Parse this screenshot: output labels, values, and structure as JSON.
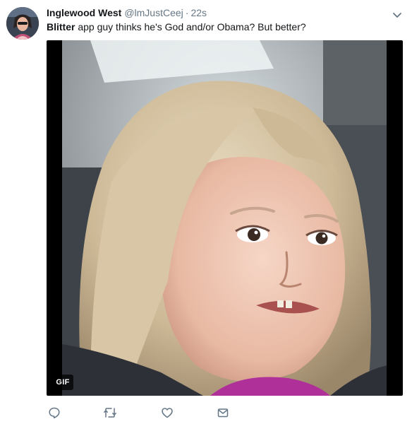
{
  "tweet": {
    "display_name": "Inglewood West",
    "handle": "@lmJustCeej",
    "separator": "·",
    "time": "22s",
    "text_bold": "Blitter",
    "text_rest": " app guy thinks he's God and/or Obama? But better?"
  },
  "media": {
    "badge": "GIF"
  },
  "icons": {
    "more": "chevron-down-icon",
    "reply": "reply-icon",
    "retweet": "retweet-icon",
    "like": "heart-icon",
    "message": "envelope-icon"
  },
  "colors": {
    "name": "#14171a",
    "secondary": "#657786",
    "icon": "#657786"
  }
}
